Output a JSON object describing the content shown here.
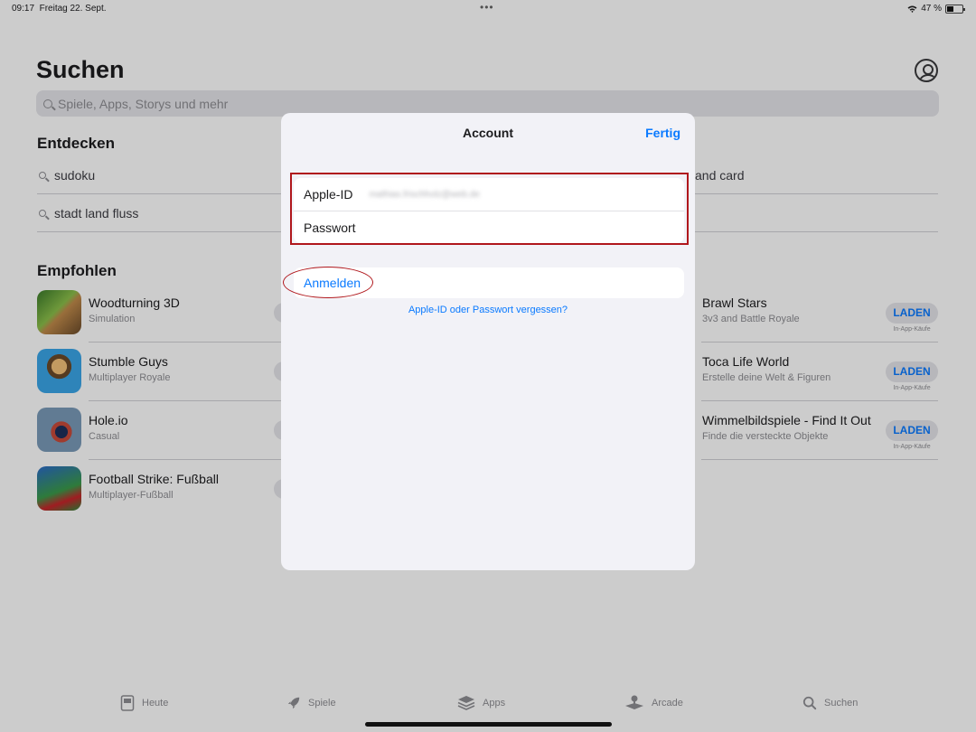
{
  "status_bar": {
    "time": "09:17",
    "date": "Freitag 22. Sept.",
    "battery": "47 %",
    "dots": "•••"
  },
  "page": {
    "title": "Suchen"
  },
  "search": {
    "placeholder": "Spiele, Apps, Storys und mehr"
  },
  "discover": {
    "title": "Entdecken",
    "left_items": [
      "sudoku",
      "stadt land fluss"
    ],
    "right_items": [
      "and card",
      ""
    ]
  },
  "recommended": {
    "title": "Empfohlen",
    "left_apps": [
      {
        "name": "Woodturning 3D",
        "subtitle": "Simulation"
      },
      {
        "name": "Stumble Guys",
        "subtitle": "Multiplayer Royale"
      },
      {
        "name": "Hole.io",
        "subtitle": "Casual"
      },
      {
        "name": "Football Strike: Fußball",
        "subtitle": "Multiplayer-Fußball"
      }
    ],
    "right_apps": [
      {
        "name": "Brawl Stars",
        "subtitle": "3v3 and Battle Royale",
        "button": "LADEN",
        "note": "In-App-Käufe"
      },
      {
        "name": "Toca Life World",
        "subtitle": "Erstelle deine Welt & Figuren",
        "button": "LADEN",
        "note": "In-App-Käufe"
      },
      {
        "name": "Wimmelbildspiele - Find It Out",
        "subtitle": "Finde die versteckte Objekte",
        "button": "LADEN",
        "note": "In-App-Käufe"
      }
    ]
  },
  "tabs": [
    {
      "label": "Heute",
      "icon": "today-icon"
    },
    {
      "label": "Spiele",
      "icon": "rocket-icon"
    },
    {
      "label": "Apps",
      "icon": "apps-stack-icon"
    },
    {
      "label": "Arcade",
      "icon": "joystick-icon"
    },
    {
      "label": "Suchen",
      "icon": "search-icon"
    }
  ],
  "modal": {
    "title": "Account",
    "done": "Fertig",
    "apple_id_label": "Apple-ID",
    "apple_id_value": "mathias.frischholz@web.de",
    "password_label": "Passwort",
    "sign_in": "Anmelden",
    "forgot": "Apple-ID oder Passwort vergessen?"
  },
  "colors": {
    "accent": "#0a7aff",
    "annotation": "#b0171c"
  }
}
